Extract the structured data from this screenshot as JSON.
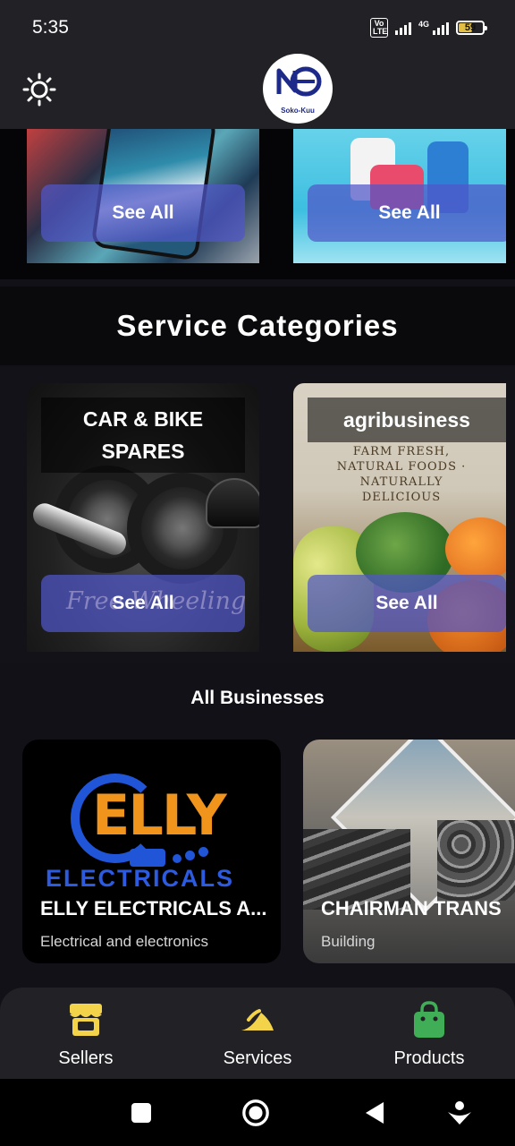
{
  "status_bar": {
    "time": "5:35",
    "volte_label": "Vo LTE",
    "network_label": "4G",
    "battery_level": "59",
    "battery_fraction": 0.59
  },
  "header": {
    "theme_icon": "sun-icon",
    "logo_text": "Soko-Kuu"
  },
  "top_categories": [
    {
      "see_all_label": "See All"
    },
    {
      "see_all_label": "See All"
    }
  ],
  "service_section": {
    "title": "Service Categories",
    "cards": [
      {
        "label": "CAR & BIKE SPARES",
        "see_all_label": "See All",
        "watermark": "Free Wheeling"
      },
      {
        "label": "agribusiness",
        "see_all_label": "See All",
        "image_text": "FARM FRESH, NATURAL FOODS · NATURALLY DELICIOUS"
      }
    ]
  },
  "businesses": {
    "title": "All Businesses",
    "items": [
      {
        "name": "ELLY ELECTRICALS A...",
        "category": "Electrical and electronics",
        "logo_word": "ELLY",
        "logo_sub": "ELECTRICALS"
      },
      {
        "name": "CHAIRMAN TRANS",
        "category": "Building"
      }
    ]
  },
  "bottom_nav": [
    {
      "label": "Sellers",
      "icon": "store-icon",
      "color": "#f3d34a"
    },
    {
      "label": "Services",
      "icon": "services-icon",
      "color": "#f3d34a"
    },
    {
      "label": "Products",
      "icon": "shopping-bag-icon",
      "color": "#3fae56"
    }
  ],
  "system_nav": [
    "recents-icon",
    "home-icon",
    "back-icon",
    "assistant-icon"
  ]
}
